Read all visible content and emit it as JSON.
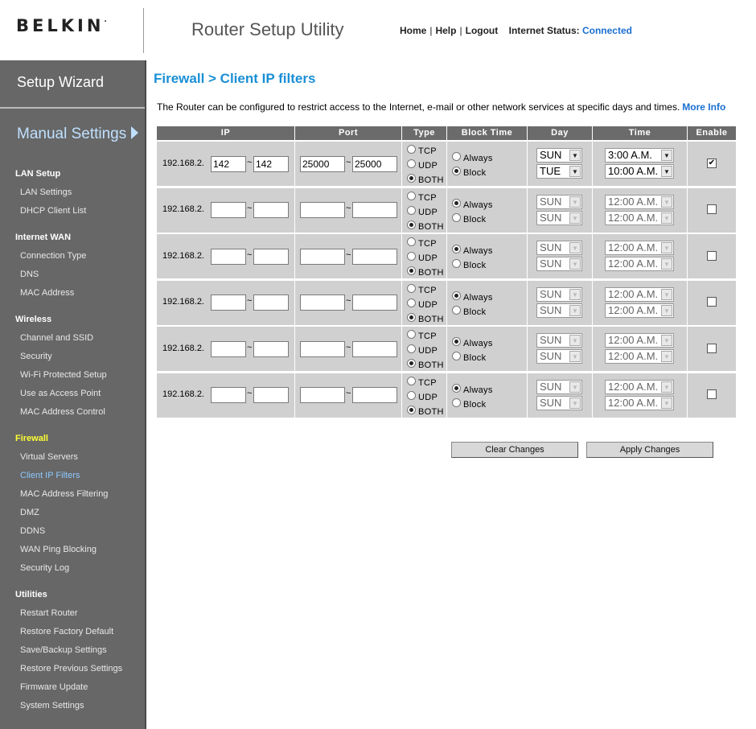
{
  "header": {
    "logo": "BELKIN",
    "logo_mark": ".",
    "app_title": "Router Setup Utility",
    "nav": [
      "Home",
      "Help",
      "Logout"
    ],
    "nav_sep": "|",
    "status_label": "Internet Status:",
    "status_value": "Connected"
  },
  "sidebar": {
    "setup_wizard": "Setup Wizard",
    "manual_settings": "Manual Settings",
    "sections": [
      {
        "title": "LAN Setup",
        "items": [
          "LAN Settings",
          "DHCP Client List"
        ]
      },
      {
        "title": "Internet WAN",
        "items": [
          "Connection Type",
          "DNS",
          "MAC Address"
        ]
      },
      {
        "title": "Wireless",
        "items": [
          "Channel and SSID",
          "Security",
          "Wi-Fi Protected Setup",
          "Use as Access Point",
          "MAC Address Control"
        ]
      },
      {
        "title": "Firewall",
        "items": [
          "Virtual Servers",
          "Client IP Filters",
          "MAC Address Filtering",
          "DMZ",
          "DDNS",
          "WAN Ping Blocking",
          "Security Log"
        ]
      },
      {
        "title": "Utilities",
        "items": [
          "Restart Router",
          "Restore Factory Default",
          "Save/Backup Settings",
          "Restore Previous Settings",
          "Firmware Update",
          "System Settings"
        ]
      }
    ],
    "active_item": "Client IP Filters"
  },
  "main": {
    "title": "Firewall > Client IP filters",
    "description": "The Router can be configured to restrict access to the Internet, e-mail or other network services at specific days and times.",
    "more_info": "More Info",
    "columns": [
      "IP",
      "Port",
      "Type",
      "Block Time",
      "Day",
      "Time",
      "Enable"
    ],
    "type_options": [
      "TCP",
      "UDP",
      "BOTH"
    ],
    "block_options": [
      "Always",
      "Block"
    ],
    "ip_prefix": "192.168.2.",
    "tilde": "~",
    "rows": [
      {
        "ip_start": "142",
        "ip_end": "142",
        "port_start": "25000",
        "port_end": "25000",
        "type": "BOTH",
        "block": "Block",
        "day_from": "SUN",
        "day_to": "TUE",
        "time_from": "3:00 A.M.",
        "time_to": "10:00 A.M.",
        "enabled": true
      },
      {
        "ip_start": "",
        "ip_end": "",
        "port_start": "",
        "port_end": "",
        "type": "BOTH",
        "block": "Always",
        "day_from": "SUN",
        "day_to": "SUN",
        "time_from": "12:00 A.M.",
        "time_to": "12:00 A.M.",
        "enabled": false
      },
      {
        "ip_start": "",
        "ip_end": "",
        "port_start": "",
        "port_end": "",
        "type": "BOTH",
        "block": "Always",
        "day_from": "SUN",
        "day_to": "SUN",
        "time_from": "12:00 A.M.",
        "time_to": "12:00 A.M.",
        "enabled": false
      },
      {
        "ip_start": "",
        "ip_end": "",
        "port_start": "",
        "port_end": "",
        "type": "BOTH",
        "block": "Always",
        "day_from": "SUN",
        "day_to": "SUN",
        "time_from": "12:00 A.M.",
        "time_to": "12:00 A.M.",
        "enabled": false
      },
      {
        "ip_start": "",
        "ip_end": "",
        "port_start": "",
        "port_end": "",
        "type": "BOTH",
        "block": "Always",
        "day_from": "SUN",
        "day_to": "SUN",
        "time_from": "12:00 A.M.",
        "time_to": "12:00 A.M.",
        "enabled": false
      },
      {
        "ip_start": "",
        "ip_end": "",
        "port_start": "",
        "port_end": "",
        "type": "BOTH",
        "block": "Always",
        "day_from": "SUN",
        "day_to": "SUN",
        "time_from": "12:00 A.M.",
        "time_to": "12:00 A.M.",
        "enabled": false
      }
    ],
    "clear_button": "Clear Changes",
    "apply_button": "Apply Changes"
  },
  "colors": {
    "accent": "#1a8fd6",
    "sidebar_bg": "#676767",
    "header_cell": "#6b6b6b",
    "cell_bg": "#d0d0d0",
    "firewall_section": "#ffff33"
  },
  "icons": {
    "manual_arrow": "triangle-right-icon",
    "dropdown": "chevron-down-icon",
    "checkbox": "checkmark-icon"
  }
}
